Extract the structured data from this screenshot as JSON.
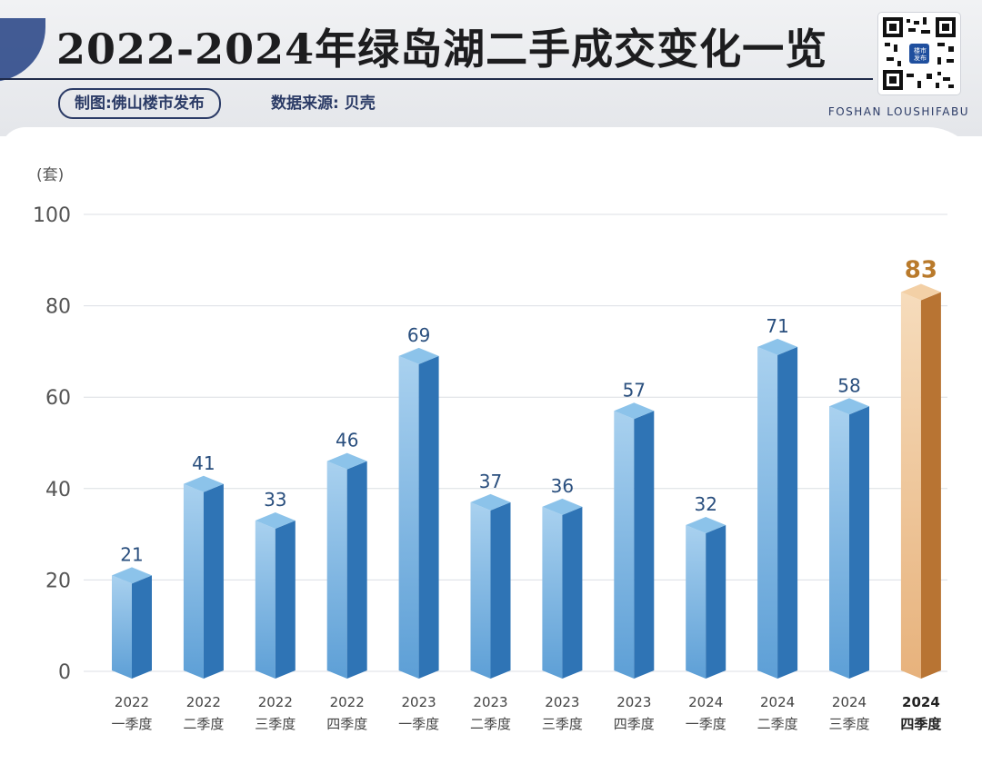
{
  "header": {
    "title": "2022-2024年绿岛湖二手成交变化一览",
    "credit": "制图:佛山楼市发布",
    "source": "数据来源: 贝壳",
    "brand": "FOSHAN LOUSHIFABU",
    "qr_label": "楼市发布"
  },
  "chart_data": {
    "type": "bar",
    "ylabel": "(套)",
    "ylim": [
      0,
      100
    ],
    "yticks": [
      0,
      20,
      40,
      60,
      80,
      100
    ],
    "grid": true,
    "categories": [
      [
        "2022",
        "一季度"
      ],
      [
        "2022",
        "二季度"
      ],
      [
        "2022",
        "三季度"
      ],
      [
        "2022",
        "四季度"
      ],
      [
        "2023",
        "一季度"
      ],
      [
        "2023",
        "二季度"
      ],
      [
        "2023",
        "三季度"
      ],
      [
        "2023",
        "四季度"
      ],
      [
        "2024",
        "一季度"
      ],
      [
        "2024",
        "二季度"
      ],
      [
        "2024",
        "三季度"
      ],
      [
        "2024",
        "四季度"
      ]
    ],
    "values": [
      21,
      41,
      33,
      46,
      69,
      37,
      36,
      57,
      32,
      71,
      58,
      83
    ],
    "highlight_index": 11,
    "colors": {
      "bar_front": "#5d9fd6",
      "bar_side": "#2f74b5",
      "bar_top": "#8cc3ea",
      "label": "#2a4f7e",
      "highlight_front": "#e7b27c",
      "highlight_side": "#b87433",
      "highlight_top": "#f3d0a6",
      "highlight_label": "#b97a2b",
      "grid": "#dcdfe4",
      "tick": "#555555"
    }
  }
}
